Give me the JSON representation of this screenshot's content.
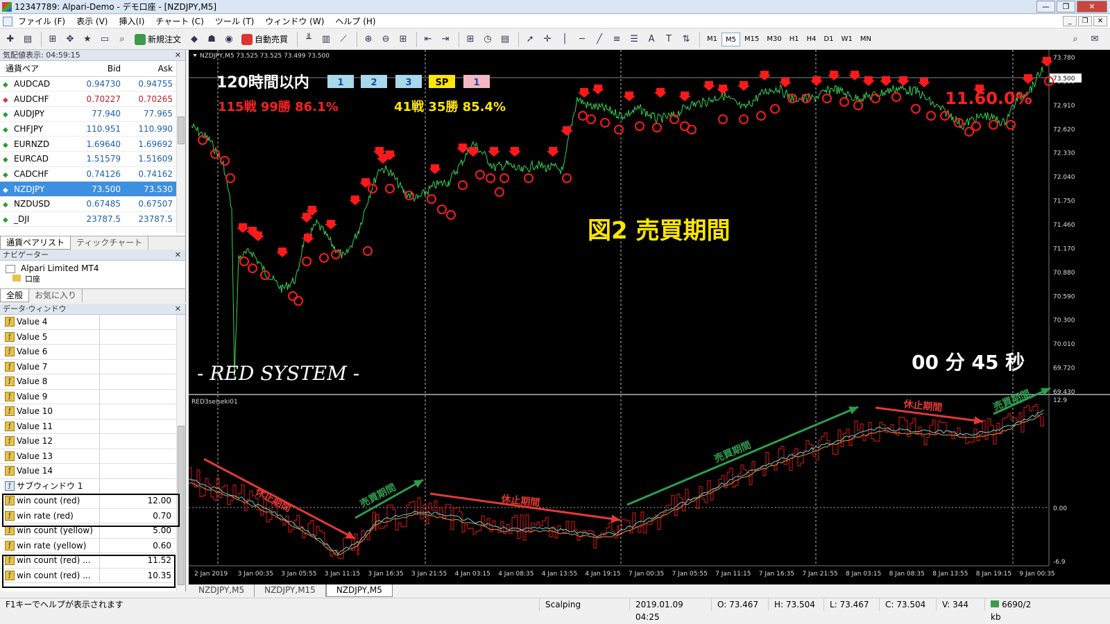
{
  "window": {
    "title": "12347789: Alpari-Demo - デモ口座 - [NZDJPY,M5]",
    "min": "—",
    "max": "❐",
    "close": "✕"
  },
  "menu": [
    "ファイル (F)",
    "表示 (V)",
    "挿入(I)",
    "チャート (C)",
    "ツール (T)",
    "ウィンドウ (W)",
    "ヘルプ (H)"
  ],
  "toolbar": {
    "new_order": "新規注文",
    "auto_trade": "自動売買",
    "timeframes": [
      "M1",
      "M5",
      "M15",
      "M30",
      "H1",
      "H4",
      "D1",
      "W1",
      "MN"
    ],
    "active_tf": "M5"
  },
  "market_watch": {
    "title": "気配値表示: 04:59:15",
    "col_symbol": "通貨ペア",
    "col_bid": "Bid",
    "col_ask": "Ask",
    "rows": [
      {
        "symbol": "AUDCAD",
        "bid": "0.94730",
        "ask": "0.94755",
        "dir": "up"
      },
      {
        "symbol": "AUDCHF",
        "bid": "0.70227",
        "ask": "0.70265",
        "dir": "down"
      },
      {
        "symbol": "AUDJPY",
        "bid": "77.940",
        "ask": "77.965",
        "dir": "up"
      },
      {
        "symbol": "CHFJPY",
        "bid": "110.951",
        "ask": "110.990",
        "dir": "up"
      },
      {
        "symbol": "EURNZD",
        "bid": "1.69640",
        "ask": "1.69692",
        "dir": "up"
      },
      {
        "symbol": "EURCAD",
        "bid": "1.51579",
        "ask": "1.51609",
        "dir": "up"
      },
      {
        "symbol": "CADCHF",
        "bid": "0.74126",
        "ask": "0.74162",
        "dir": "up"
      },
      {
        "symbol": "NZDJPY",
        "bid": "73.500",
        "ask": "73.530",
        "dir": "up",
        "selected": true
      },
      {
        "symbol": "NZDUSD",
        "bid": "0.67485",
        "ask": "0.67507",
        "dir": "up"
      },
      {
        "symbol": "_DJI",
        "bid": "23787.5",
        "ask": "23787.5",
        "dir": "up"
      }
    ],
    "tabs": [
      "通貨ペアリスト",
      "ティックチャート"
    ]
  },
  "navigator": {
    "title": "ナビゲーター",
    "root": "Alpari Limited MT4",
    "child": "口座",
    "tabs": [
      "全般",
      "お気に入り"
    ]
  },
  "data_window": {
    "title": "データ·ウィンドウ",
    "rows": [
      {
        "label": "Value 4",
        "value": ""
      },
      {
        "label": "Value 5",
        "value": ""
      },
      {
        "label": "Value 6",
        "value": ""
      },
      {
        "label": "Value 7",
        "value": ""
      },
      {
        "label": "Value 8",
        "value": ""
      },
      {
        "label": "Value 9",
        "value": ""
      },
      {
        "label": "Value 10",
        "value": ""
      },
      {
        "label": "Value 11",
        "value": ""
      },
      {
        "label": "Value 12",
        "value": ""
      },
      {
        "label": "Value 13",
        "value": ""
      },
      {
        "label": "Value 14",
        "value": ""
      },
      {
        "label": "サブウィンドウ 1",
        "value": "",
        "sub": true
      },
      {
        "label": "win count (red)",
        "value": "12.00"
      },
      {
        "label": "win rate (red)",
        "value": "0.70"
      },
      {
        "label": "win count (yellow)",
        "value": "5.00"
      },
      {
        "label": "win rate (yellow)",
        "value": "0.60"
      },
      {
        "label": "win count (red) ...",
        "value": "11.52"
      },
      {
        "label": "win count (red) ...",
        "value": "10.35"
      }
    ]
  },
  "chart": {
    "header": "NZDJPY,M5  73.525 73.525 73.499 73.500",
    "stats_title": "120時間以内",
    "badges": [
      "1",
      "2",
      "3",
      "SP",
      "1"
    ],
    "red_stats": "115戦  99勝   86.1%",
    "yellow_stats": "41戦  35勝   85.4%",
    "right_overlay": "11.60.0%",
    "caption": "図2  売買期間",
    "timer": "00 分 45 秒",
    "system": "- RED SYSTEM -",
    "subwindow_label": "RED3seiseki01",
    "sub_top": "12.9",
    "sub_mid": "0.00",
    "sub_bottom": "-6.9",
    "current_price": "73.500",
    "price_axis": [
      "73.780",
      "73.200",
      "72.910",
      "72.620",
      "72.330",
      "72.040",
      "71.750",
      "71.460",
      "71.170",
      "70.880",
      "70.590",
      "70.300",
      "70.010",
      "69.720",
      "69.430"
    ],
    "time_axis": [
      "2 Jan 2019",
      "3 Jan 00:35",
      "3 Jan 05:55",
      "3 Jan 11:15",
      "3 Jan 16:35",
      "3 Jan 21:55",
      "4 Jan 03:15",
      "4 Jan 08:35",
      "4 Jan 13:55",
      "4 Jan 19:15",
      "7 Jan 00:35",
      "7 Jan 05:55",
      "7 Jan 11:15",
      "7 Jan 16:35",
      "7 Jan 21:55",
      "8 Jan 03:15",
      "8 Jan 08:35",
      "8 Jan 13:55",
      "8 Jan 19:15",
      "9 Jan 00:35"
    ],
    "annotations": [
      {
        "text": "休止期間",
        "color": "#e53935"
      },
      {
        "text": "売買期間",
        "color": "#2e9e4f"
      },
      {
        "text": "休止期間",
        "color": "#e53935"
      },
      {
        "text": "売買期間",
        "color": "#2e9e4f"
      },
      {
        "text": "休止期間",
        "color": "#e53935"
      },
      {
        "text": "売買期間",
        "color": "#2e9e4f"
      }
    ]
  },
  "bottom_tabs": [
    "NZDJPY,M5",
    "NZDJPY,M15",
    "NZDJPY,M5"
  ],
  "status": {
    "help": "F1キーでヘルプが表示されます",
    "profile": "Scalping",
    "datetime": "2019.01.09 04:25",
    "open": "O: 73.467",
    "high": "H: 73.504",
    "low": "L: 73.467",
    "close": "C: 73.504",
    "volume": "V: 344",
    "traffic": "6690/2 kb"
  },
  "colors": {
    "price_line": "#39d353",
    "signal": "#ff1a1a",
    "accent_yellow": "#ffe600",
    "badge_blue": "#a8d8ea",
    "badge_pink": "#f4b6c2"
  }
}
